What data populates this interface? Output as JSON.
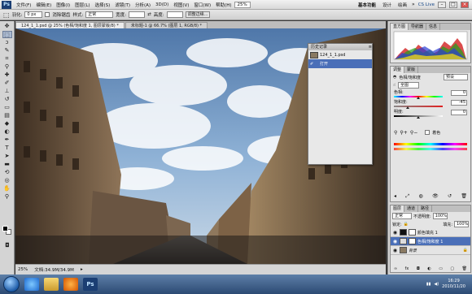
{
  "menubar": {
    "logo": "Ps",
    "items": [
      "文件(F)",
      "编辑(E)",
      "图像(I)",
      "图层(L)",
      "选择(S)",
      "滤镜(T)",
      "分析(A)",
      "3D(D)",
      "视图(V)",
      "窗口(W)",
      "帮助(H)"
    ],
    "zoom": "25%",
    "workspaces": [
      "基本功能",
      "设计",
      "绘画"
    ],
    "cslive": "CS Live"
  },
  "options": {
    "feather_label": "羽化:",
    "feather_value": "0 px",
    "antialias": "消除锯齿",
    "style_label": "样式:",
    "style_value": "正常",
    "width_label": "宽度:",
    "height_label": "高度:",
    "refine_edge": "调整边缘..."
  },
  "tabs": [
    {
      "label": "124_1_1.psd @ 25% (色相/饱和度 1, 图层蒙版/8) *",
      "active": true
    },
    {
      "label": "未标题-1 @ 66.7% (图层 1, RGB/8) *",
      "active": false
    }
  ],
  "statusbar": {
    "zoom": "25%",
    "doc_info": "文档:34.9M/34.9M"
  },
  "history_dialog": {
    "title": "历史记录",
    "snapshot": "124_1_1.psd",
    "step": "打开"
  },
  "histogram_panel": {
    "tabs": [
      "直方图",
      "导航器",
      "信息"
    ]
  },
  "adjust_panel": {
    "tabs": [
      "调整",
      "蒙版"
    ],
    "title": "色相/饱和度",
    "preset_label": "预设",
    "channel": "全图",
    "hue_label": "色相:",
    "hue_value": "0",
    "hue_pos": 0.5,
    "sat_label": "饱和度:",
    "sat_value": "-45",
    "sat_pos": 0.275,
    "light_label": "明度:",
    "light_value": "0",
    "light_pos": 0.5,
    "colorize": "着色"
  },
  "layers_panel": {
    "tabs": [
      "图层",
      "通道",
      "路径"
    ],
    "blend_mode": "正常",
    "opacity_label": "不透明度:",
    "opacity_value": "100%",
    "lock_label": "锁定:",
    "fill_label": "填充:",
    "fill_value": "100%",
    "layers": [
      {
        "name": "颜色填充 1",
        "selected": false,
        "thumb": "#111111"
      },
      {
        "name": "色相/饱和度 1",
        "selected": true,
        "thumb": "#ffffff"
      },
      {
        "name": "背景",
        "selected": false,
        "thumb": "#8a7a62"
      }
    ]
  },
  "taskbar": {
    "time": "16:29",
    "date": "2010/11/20"
  }
}
